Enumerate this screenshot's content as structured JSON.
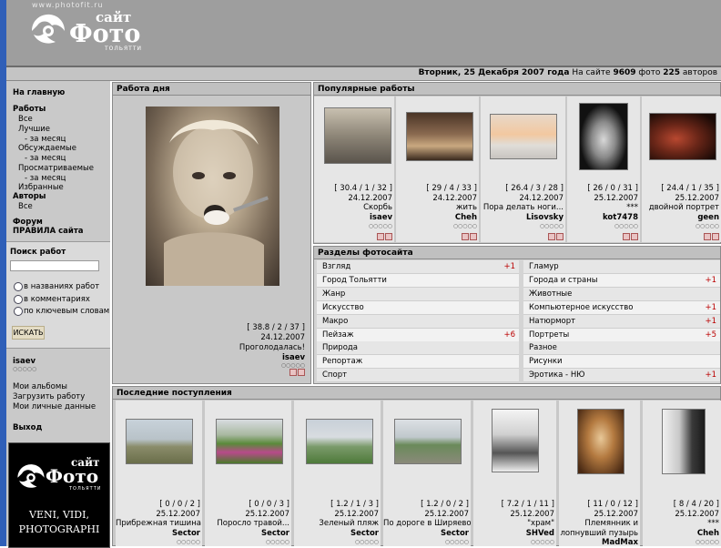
{
  "header": {
    "site_url": "www.photofit.ru",
    "logo_top": "сайт",
    "logo_main": "Фото",
    "logo_sub": "ТОЛЬЯТТИ"
  },
  "status": {
    "date": "Вторник, 25 Декабря 2007 года",
    "on_site": "На сайте",
    "photos_count": "9609",
    "photos_word": "фото",
    "authors_count": "225",
    "authors_word": "авторов"
  },
  "sidebar": {
    "home": "На главную",
    "works": "Работы",
    "all": "Все",
    "best": "Лучшие",
    "best_month": "- за месяц",
    "discussed": "Обсуждаемые",
    "discussed_month": "- за месяц",
    "viewed": "Просматриваемые",
    "viewed_month": "- за месяц",
    "favorites": "Избранные",
    "authors": "Авторы",
    "authors_all": "Все",
    "forum": "Форум",
    "rules": "ПРАВИЛА сайта",
    "search_title": "Поиск работ",
    "search_opt1": "в названиях работ",
    "search_opt2": "в комментариях",
    "search_opt3": "по ключевым словам",
    "search_button": "ИСКАТЬ",
    "user": "isaev",
    "user_dots": "○○○○○",
    "my_albums": "Мои альбомы",
    "upload": "Загрузить работу",
    "my_data": "Мои личные данные",
    "logout": "Выход",
    "promo_top": "сайт",
    "promo_main": "Фото",
    "promo_sub": "ТОЛЬЯТТИ",
    "promo_line1": "VENI, VIDI,",
    "promo_line2": "PHOTOGRAPHI"
  },
  "work_of_day": {
    "title": "Работа дня",
    "stats": "[ 38.8 / 2 / 37 ]",
    "date": "24.12.2007",
    "name": "Проголодалась!",
    "author": "isaev",
    "dots": "○○○○○"
  },
  "popular": {
    "title": "Популярные работы",
    "items": [
      {
        "stats": "[ 30.4 / 1 / 32 ]",
        "date": "24.12.2007",
        "name": "Скорбь",
        "author": "isaev",
        "dots": "○○○○○"
      },
      {
        "stats": "[ 29 / 4 / 33 ]",
        "date": "24.12.2007",
        "name": "жить",
        "author": "Cheh",
        "dots": "○○○○○"
      },
      {
        "stats": "[ 26.4 / 3 / 28 ]",
        "date": "24.12.2007",
        "name": "Пора делать ноги...",
        "author": "Lisovsky",
        "dots": "○○○○○"
      },
      {
        "stats": "[ 26 / 0 / 31 ]",
        "date": "25.12.2007",
        "name": "***",
        "author": "kot7478",
        "dots": "○○○○○"
      },
      {
        "stats": "[ 24.4 / 1 / 35 ]",
        "date": "25.12.2007",
        "name": "двойной портрет",
        "author": "geen",
        "dots": "○○○○○"
      }
    ]
  },
  "sections": {
    "title": "Разделы фотосайта",
    "left": [
      {
        "name": "Взгляд",
        "val": "+1"
      },
      {
        "name": "Город Тольятти",
        "val": ""
      },
      {
        "name": "Жанр",
        "val": ""
      },
      {
        "name": "Искусство",
        "val": ""
      },
      {
        "name": "Макро",
        "val": ""
      },
      {
        "name": "Пейзаж",
        "val": "+6"
      },
      {
        "name": "Природа",
        "val": ""
      },
      {
        "name": "Репортаж",
        "val": ""
      },
      {
        "name": "Спорт",
        "val": ""
      }
    ],
    "right": [
      {
        "name": "Гламур",
        "val": ""
      },
      {
        "name": "Города и страны",
        "val": "+1"
      },
      {
        "name": "Животные",
        "val": ""
      },
      {
        "name": "Компьютерное искусство",
        "val": "+1"
      },
      {
        "name": "Натюрморт",
        "val": "+1"
      },
      {
        "name": "Портреты",
        "val": "+5"
      },
      {
        "name": "Разное",
        "val": ""
      },
      {
        "name": "Рисунки",
        "val": ""
      },
      {
        "name": "Эротика - НЮ",
        "val": "+1"
      }
    ]
  },
  "latest": {
    "title": "Последние поступления",
    "items": [
      {
        "stats": "[ 0 / 0 / 2 ]",
        "date": "25.12.2007",
        "name": "Прибрежная тишина",
        "author": "Sector",
        "dots": "○○○○○"
      },
      {
        "stats": "[ 0 / 0 / 3 ]",
        "date": "25.12.2007",
        "name": "Поросло травой...",
        "author": "Sector",
        "dots": "○○○○○"
      },
      {
        "stats": "[ 1.2 / 1 / 3 ]",
        "date": "25.12.2007",
        "name": "Зеленый пляж",
        "author": "Sector",
        "dots": "○○○○○"
      },
      {
        "stats": "[ 1.2 / 0 / 2 ]",
        "date": "25.12.2007",
        "name": "По дороге в Ширяево",
        "author": "Sector",
        "dots": "○○○○○"
      },
      {
        "stats": "[ 7.2 / 1 / 11 ]",
        "date": "25.12.2007",
        "name": "\"храм\"",
        "author": "SHVed",
        "dots": "○○○○○"
      },
      {
        "stats": "[ 11 / 0 / 12 ]",
        "date": "25.12.2007",
        "name": "Племянник и",
        "name2": "лопнувший пузырь",
        "author": "MadMax",
        "dots": "○○○○○"
      },
      {
        "stats": "[ 8 / 4 / 20 ]",
        "date": "25.12.2007",
        "name": "***",
        "author": "Cheh",
        "dots": "○○○○○"
      }
    ]
  }
}
